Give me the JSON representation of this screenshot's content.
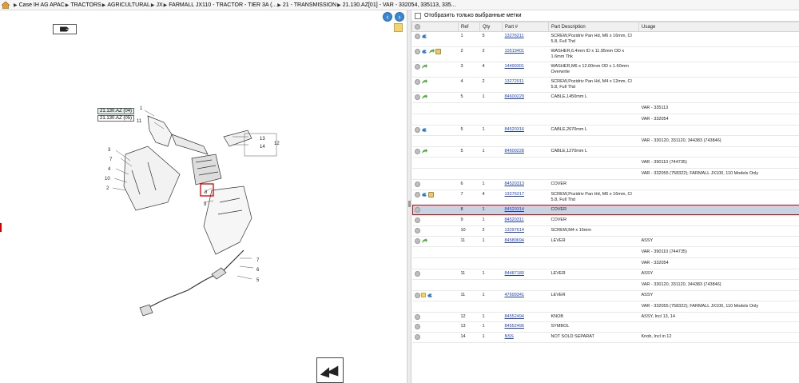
{
  "breadcrumb": [
    "Case IH AG APAC",
    "TRACTORS",
    "AGRICULTURAL",
    "JX",
    "FARMALL JX110 - TRACTOR - TIER 3A (...",
    "21 - TRANSMISSION",
    "21.130.AZ[01] - VAR - 332054, 335113, 335..."
  ],
  "diagram": {
    "labels_boxed": [
      "21.130.AZ (04)",
      "21.130.AZ (05)"
    ],
    "callouts": [
      "1",
      "11",
      "13",
      "14",
      "12",
      "3",
      "7",
      "4",
      "10",
      "2",
      "8",
      "9",
      "7",
      "6",
      "5"
    ]
  },
  "filter_label": "Отобразить только выбранные метки",
  "table": {
    "headers": [
      "",
      "Ref",
      "Qty",
      "Part #",
      "Part Description",
      "Usage"
    ],
    "rows": [
      {
        "icons": [
          "plus",
          "blue"
        ],
        "ref": "1",
        "qty": "5",
        "part": "13276211",
        "desc": "SCREW,Pozidriv Pan Hd, M6 x 16mm, Cl 5.8, Full Thd",
        "usage": ""
      },
      {
        "icons": [
          "plus",
          "blue",
          "green",
          "box"
        ],
        "ref": "2",
        "qty": "2",
        "part": "10519401",
        "desc": "WASHER,6.4mm ID x 11.95mm OD x 1.6mm Thk",
        "usage": ""
      },
      {
        "icons": [
          "plus",
          "green"
        ],
        "ref": "3",
        "qty": "4",
        "part": "14499301",
        "desc": "WASHER,M6 x 12.00mm OD x 1.60mm Overwrite",
        "usage": ""
      },
      {
        "icons": [
          "plus",
          "green"
        ],
        "ref": "4",
        "qty": "2",
        "part": "13272011",
        "desc": "SCREW,Pozidriv Pan Hd, M4 x 12mm, Cl 5.8, Full Thd",
        "usage": ""
      },
      {
        "icons": [
          "plus",
          "green"
        ],
        "ref": "5",
        "qty": "1",
        "part": "84600229",
        "desc": "CABLE,1450mm L",
        "usage": ""
      },
      {
        "sub": true,
        "usage": "VAR - 335113"
      },
      {
        "sub": true,
        "usage": "VAR - 332054"
      },
      {
        "icons": [
          "plus",
          "blue"
        ],
        "ref": "5",
        "qty": "1",
        "part": "84520316",
        "desc": "CABLE,2670mm L",
        "usage": ""
      },
      {
        "sub": true,
        "usage": "VAR - 330120, 331120, 344383 (743846)"
      },
      {
        "icons": [
          "plus",
          "green"
        ],
        "ref": "5",
        "qty": "1",
        "part": "84600228",
        "desc": "CABLE,1270mm L",
        "usage": ""
      },
      {
        "sub": true,
        "usage": "VAR - 390110 (744735)"
      },
      {
        "sub": true,
        "usage": "VAR - 332055 (758322); FARMALL JX100, 110 Models Only"
      },
      {
        "icons": [
          "plus"
        ],
        "ref": "6",
        "qty": "1",
        "part": "84520313",
        "desc": "COVER",
        "usage": ""
      },
      {
        "icons": [
          "plus",
          "blue",
          "box"
        ],
        "ref": "7",
        "qty": "4",
        "part": "13276217",
        "desc": "SCREW,Pozidriv Pan Hd, M6 x 16mm, Cl 5.8, Full Thd",
        "usage": ""
      },
      {
        "icons": [
          "plus"
        ],
        "ref": "8",
        "qty": "1",
        "part": "84520314",
        "desc": "COVER",
        "usage": "",
        "selected": true
      },
      {
        "icons": [
          "plus"
        ],
        "ref": "9",
        "qty": "1",
        "part": "84520311",
        "desc": "COVER",
        "usage": ""
      },
      {
        "icons": [
          "plus"
        ],
        "ref": "10",
        "qty": "2",
        "part": "13297614",
        "desc": "SCREW,M4 x 16mm",
        "usage": ""
      },
      {
        "icons": [
          "plus",
          "green"
        ],
        "ref": "11",
        "qty": "1",
        "part": "84589694",
        "desc": "LEVER",
        "usage": "ASSY"
      },
      {
        "sub": true,
        "usage": "VAR - 390110 (744735)"
      },
      {
        "sub": true,
        "usage": "VAR - 332054"
      },
      {
        "icons": [
          "plus"
        ],
        "ref": "11",
        "qty": "1",
        "part": "84487180",
        "desc": "LEVER",
        "usage": "ASSY"
      },
      {
        "sub": true,
        "usage": "VAR - 330120, 331120, 344383 (743846)"
      },
      {
        "icons": [
          "plus",
          "note",
          "blue"
        ],
        "ref": "11",
        "qty": "1",
        "part": "47699341",
        "desc": "LEVER",
        "usage": "ASSY"
      },
      {
        "sub": true,
        "usage": "VAR - 332055 (758322); FARMALL JX100, 110 Models Only"
      },
      {
        "icons": [
          "plus"
        ],
        "ref": "12",
        "qty": "1",
        "part": "84552494",
        "desc": "KNOB",
        "usage": "ASSY, Incl 13, 14"
      },
      {
        "icons": [
          "plus"
        ],
        "ref": "13",
        "qty": "1",
        "part": "84552496",
        "desc": "SYMBOL",
        "usage": ""
      },
      {
        "icons": [
          "plus"
        ],
        "ref": "14",
        "qty": "1",
        "part": "NSS",
        "desc": "NOT SOLD SEPARAT",
        "usage": "Knob, Incl in 12"
      }
    ]
  }
}
